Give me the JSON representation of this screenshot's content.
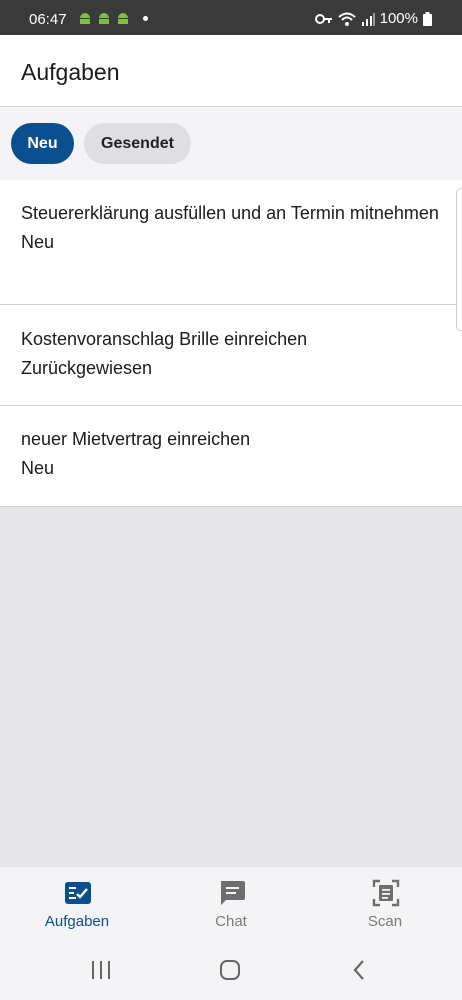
{
  "status_bar": {
    "time": "06:47",
    "battery": "100%",
    "icons": [
      "android-icon",
      "android-icon",
      "android-icon",
      "notification-dot",
      "key-icon",
      "wifi-icon",
      "signal-icon",
      "battery-icon"
    ]
  },
  "header": {
    "title": "Aufgaben"
  },
  "filters": [
    {
      "label": "Neu",
      "selected": true
    },
    {
      "label": "Gesendet",
      "selected": false
    }
  ],
  "tasks": [
    {
      "title": "Steuererklärung ausfüllen und an Termin mitnehmen",
      "status": "Neu"
    },
    {
      "title": "Kostenvoranschlag Brille einreichen",
      "status": "Zurückgewiesen"
    },
    {
      "title": "neuer Mietvertrag einreichen",
      "status": "Neu"
    }
  ],
  "bottom_nav": [
    {
      "label": "Aufgaben",
      "icon": "tasks-icon",
      "active": true
    },
    {
      "label": "Chat",
      "icon": "chat-icon",
      "active": false
    },
    {
      "label": "Scan",
      "icon": "scan-icon",
      "active": false
    }
  ],
  "colors": {
    "primary": "#0b4f8f",
    "chip_inactive": "#dfdfe2",
    "background": "#e6e5e8"
  }
}
